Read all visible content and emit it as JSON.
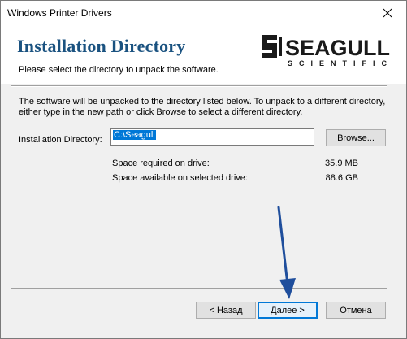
{
  "window": {
    "title": "Windows Printer Drivers"
  },
  "banner": {
    "title": "Installation Directory",
    "subtitle": "Please select the directory to unpack the software.",
    "logo_main": "SEAGULL",
    "logo_sub": "SCIENTIFIC"
  },
  "main": {
    "intro_line1": "The software will be unpacked to the directory listed below.  To unpack to a different directory,",
    "intro_line2": "either type in the new path or click Browse to select a different directory.",
    "dir_label": "Installation Directory:",
    "dir_value": "C:\\Seagull",
    "browse_label": "Browse...",
    "space_required_label": "Space required on drive:",
    "space_required_value": "35.9 MB",
    "space_available_label": "Space available on selected drive:",
    "space_available_value": "88.6 GB"
  },
  "footer": {
    "back_label": "< Назад",
    "next_label": "Далее >",
    "cancel_label": "Отмена"
  },
  "colors": {
    "title_blue": "#1a5280",
    "accent": "#0078d7",
    "annotation_arrow": "#1f4e9c"
  },
  "icons": {
    "close": "close-icon",
    "logo": "seagull-logo"
  }
}
